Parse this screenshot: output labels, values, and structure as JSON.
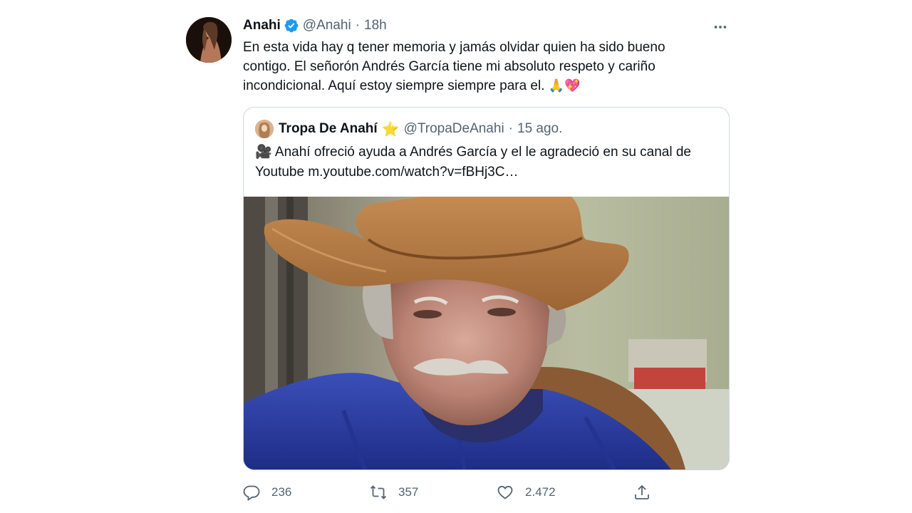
{
  "tweet": {
    "author_name": "Anahi",
    "author_handle": "@Anahi",
    "separator": "·",
    "time": "18h",
    "text_line1": "En esta vida hay q tener memoria y jamás olvidar quien ha sido bueno",
    "text_line2": "contigo. El señorón Andrés García tiene mi absoluto respeto y cariño",
    "text_line3": "incondicional. Aquí estoy siempre siempre para el. ",
    "emoji": "🙏💖",
    "icons": {
      "verified": "verified-badge-icon",
      "more": "more-options-icon"
    }
  },
  "quoted": {
    "author_name": "Tropa De Anahí",
    "star": "⭐",
    "author_handle": "@TropaDeAnahi",
    "separator": "·",
    "time": "15 ago.",
    "camera": "🎥",
    "text_line1": " Anahí ofreció ayuda a Andrés García y el le agradeció en su canal de",
    "text_line2": "Youtube  m.youtube.com/watch?v=fBHj3C…"
  },
  "actions": {
    "reply_count": "236",
    "retweet_count": "357",
    "like_count": "2.472"
  },
  "colors": {
    "verified_blue": "#1d9bf0",
    "secondary_text": "#536471",
    "border": "#cfd9de"
  }
}
